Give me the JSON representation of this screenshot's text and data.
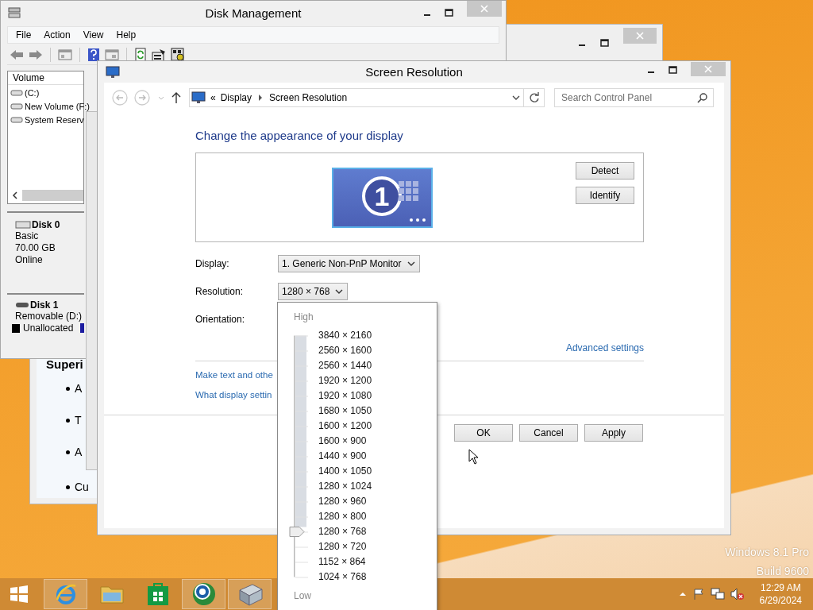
{
  "desktop": {
    "watermark": [
      "Windows 8.1 Pro",
      "Build 9600"
    ]
  },
  "back_window": {
    "heading": "Superi",
    "bullets": [
      "A",
      "T",
      "A",
      "Cu"
    ]
  },
  "disk_management": {
    "title": "Disk Management",
    "menu": [
      "File",
      "Action",
      "View",
      "Help"
    ],
    "volume_header": "Volume",
    "volumes": [
      "(C:)",
      "New Volume (F:)",
      "System Reserv"
    ],
    "disks": [
      {
        "name": "Disk 0",
        "lines": [
          "Basic",
          "70.00 GB",
          "Online"
        ]
      },
      {
        "name": "Disk 1",
        "lines": [
          "Removable (D:)"
        ],
        "partition": "Unallocated"
      }
    ]
  },
  "screen_resolution": {
    "title": "Screen Resolution",
    "overflow_mark": "«",
    "breadcrumb": [
      "Display",
      "Screen Resolution"
    ],
    "search": {
      "placeholder": "Search Control Panel"
    },
    "heading": "Change the appearance of your display",
    "monitor_number": "1",
    "side_buttons": [
      "Detect",
      "Identify"
    ],
    "fields": [
      {
        "label": "Display:",
        "value": "1. Generic Non-PnP Monitor"
      },
      {
        "label": "Resolution:",
        "value": "1280 × 768"
      },
      {
        "label": "Orientation:"
      }
    ],
    "advanced_link": "Advanced settings",
    "links": [
      "Make text and othe",
      "What display settin"
    ],
    "buttons": [
      "OK",
      "Cancel",
      "Apply"
    ]
  },
  "resolution_list": {
    "high_label": "High",
    "low_label": "Low",
    "level": 0.1875,
    "options": [
      "3840 × 2160",
      "2560 × 1600",
      "2560 × 1440",
      "1920 × 1200",
      "1920 × 1080",
      "1680 × 1050",
      "1600 × 1200",
      "1600 × 900",
      "1440 × 900",
      "1400 × 1050",
      "1280 × 1024",
      "1280 × 960",
      "1280 × 800",
      "1280 × 768",
      "1280 × 720",
      "1152 × 864",
      "1024 × 768"
    ]
  },
  "taskbar": {
    "apps": [
      {
        "kind": "browser",
        "running": true
      },
      {
        "kind": "folder",
        "running": false
      },
      {
        "kind": "store",
        "running": false
      },
      {
        "kind": "globe",
        "running": true
      },
      {
        "kind": "disk",
        "running": true
      }
    ],
    "clock": {
      "time": "12:29 AM",
      "date": "6/29/2024"
    }
  }
}
